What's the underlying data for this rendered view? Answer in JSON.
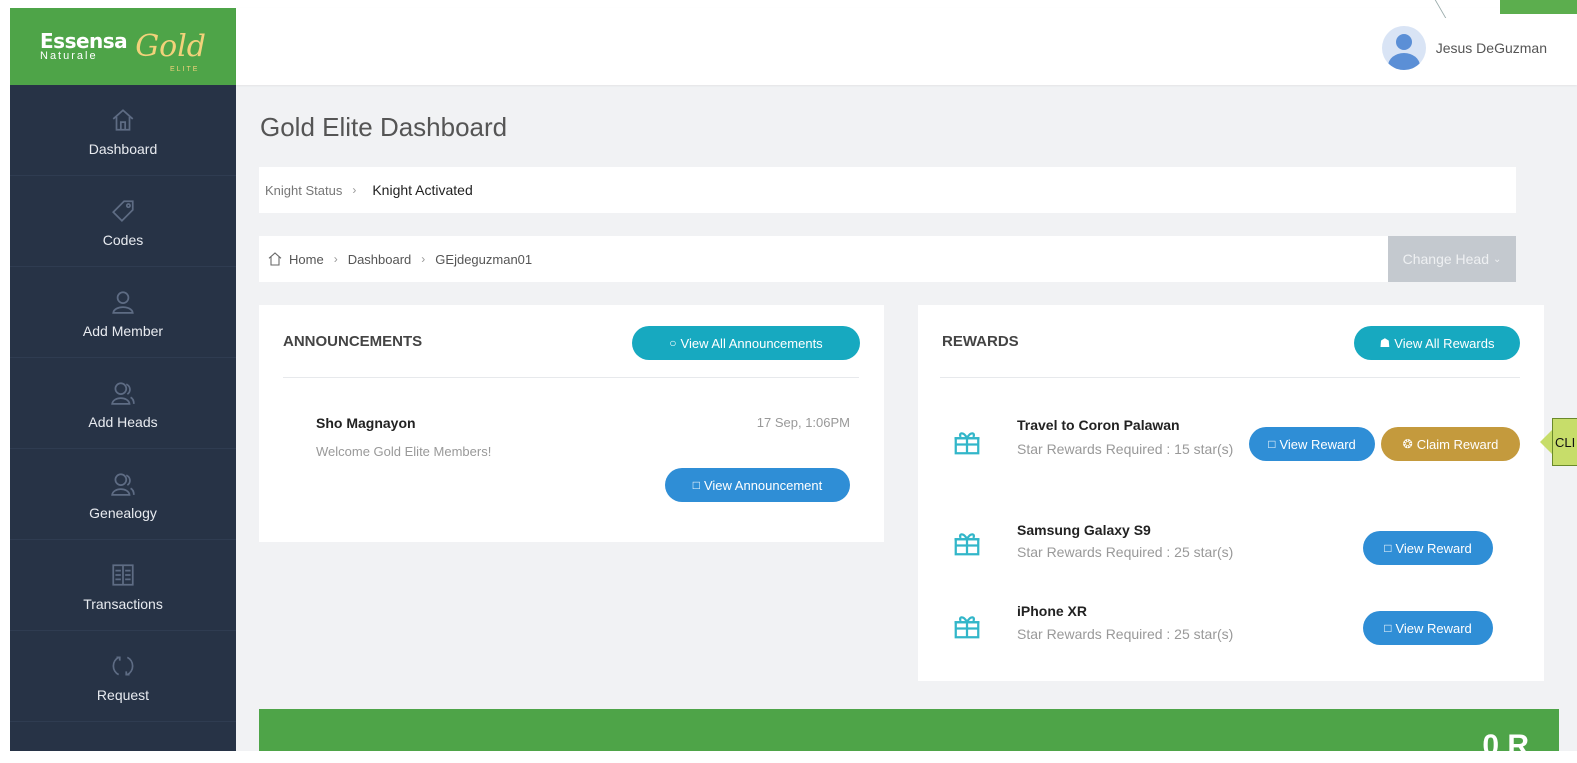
{
  "brand": {
    "main": "Essensa",
    "sub": "Naturale",
    "gold": "Gold",
    "elite": "ELITE"
  },
  "sidebar": {
    "items": [
      {
        "label": "Dashboard",
        "icon": "home-icon"
      },
      {
        "label": "Codes",
        "icon": "tag-icon"
      },
      {
        "label": "Add Member",
        "icon": "user-icon"
      },
      {
        "label": "Add Heads",
        "icon": "users-icon"
      },
      {
        "label": "Genealogy",
        "icon": "users-icon"
      },
      {
        "label": "Transactions",
        "icon": "book-icon"
      },
      {
        "label": "Request",
        "icon": "refresh-icon"
      }
    ]
  },
  "header": {
    "user_name": "Jesus DeGuzman"
  },
  "page": {
    "title": "Gold Elite Dashboard"
  },
  "knight": {
    "label": "Knight Status",
    "value": "Knight Activated"
  },
  "breadcrumb": {
    "home": "Home",
    "dashboard": "Dashboard",
    "current": "GEjdeguzman01"
  },
  "change_head": {
    "label": "Change Head"
  },
  "announcements": {
    "title": "ANNOUNCEMENTS",
    "view_all": "View All Announcements",
    "item": {
      "author": "Sho Magnayon",
      "time": "17 Sep, 1:06PM",
      "message": "Welcome Gold Elite Members!",
      "button": "View Announcement"
    }
  },
  "rewards": {
    "title": "REWARDS",
    "view_all": "View All Rewards",
    "view_label": "View Reward",
    "claim_label": "Claim Reward",
    "items": [
      {
        "name": "Travel to Coron Palawan",
        "requirement": "Star Rewards Required : 15 star(s)"
      },
      {
        "name": "Samsung Galaxy S9",
        "requirement": "Star Rewards Required : 25 star(s)"
      },
      {
        "name": "iPhone XR",
        "requirement": "Star Rewards Required : 25 star(s)"
      }
    ]
  },
  "callout": {
    "text": "CLI"
  },
  "banner": {
    "text": "0 R"
  },
  "colors": {
    "brand_green": "#4ea448",
    "sidebar": "#273346",
    "teal": "#17a9c0",
    "blue": "#2f8ed6",
    "gold": "#c49a3d"
  }
}
